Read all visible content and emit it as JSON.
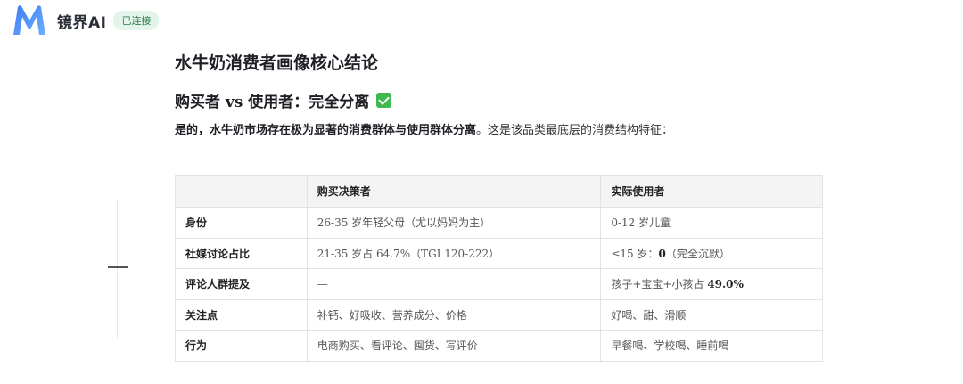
{
  "app": {
    "name": "镜界AI",
    "status": "已连接",
    "logo_icon": "m-logo-icon",
    "accent": "#4a8cf7"
  },
  "doc": {
    "title": "水牛奶消费者画像核心结论",
    "subtitle": "购买者 vs 使用者：完全分离",
    "subtitle_icon": "check-mark-icon",
    "intro_bold": "是的，水牛奶市场存在极为显著的消费群体与使用群体分离",
    "intro_rest": "。这是该品类最底层的消费结构特征："
  },
  "table": {
    "headers": [
      "",
      "购买决策者",
      "实际使用者"
    ],
    "rows": [
      {
        "label": "身份",
        "buyer": "26-35 岁年轻父母（尤以妈妈为主）",
        "user": "0-12 岁儿童"
      },
      {
        "label": "社媒讨论占比",
        "buyer": "21-35 岁占 64.7%（TGI 120-222）",
        "user_pre": "≤15 岁：",
        "user_bold": "0",
        "user_post": "（完全沉默）"
      },
      {
        "label": "评论人群提及",
        "buyer": "—",
        "user_pre": "孩子+宝宝+小孩占 ",
        "user_bold": "49.0%",
        "user_post": ""
      },
      {
        "label": "关注点",
        "buyer": "补钙、好吸收、营养成分、价格",
        "user": "好喝、甜、滑顺"
      },
      {
        "label": "行为",
        "buyer": "电商购买、看评论、囤货、写评价",
        "user": "早餐喝、学校喝、睡前喝"
      }
    ]
  }
}
